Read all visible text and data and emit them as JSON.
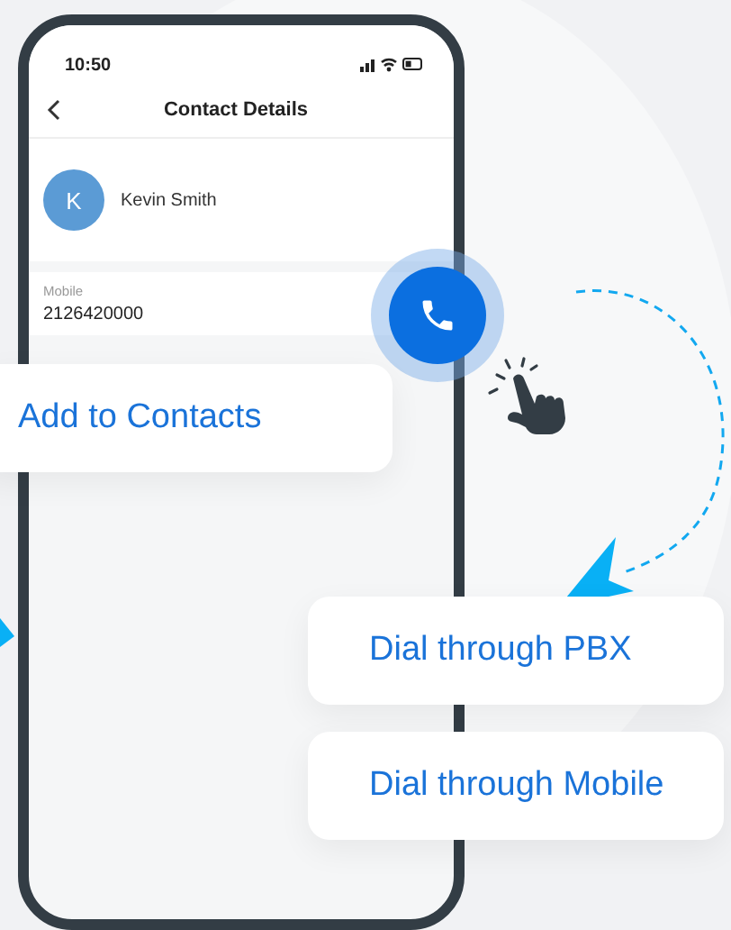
{
  "status_bar": {
    "time": "10:50"
  },
  "header": {
    "title": "Contact Details"
  },
  "contact": {
    "initial": "K",
    "name": "Kevin Smith"
  },
  "phone_field": {
    "label": "Mobile",
    "value": "2126420000"
  },
  "options": [
    {
      "label": "Add to Contacts"
    },
    {
      "label": "Dial through PBX"
    },
    {
      "label": "Dial through Mobile"
    }
  ]
}
